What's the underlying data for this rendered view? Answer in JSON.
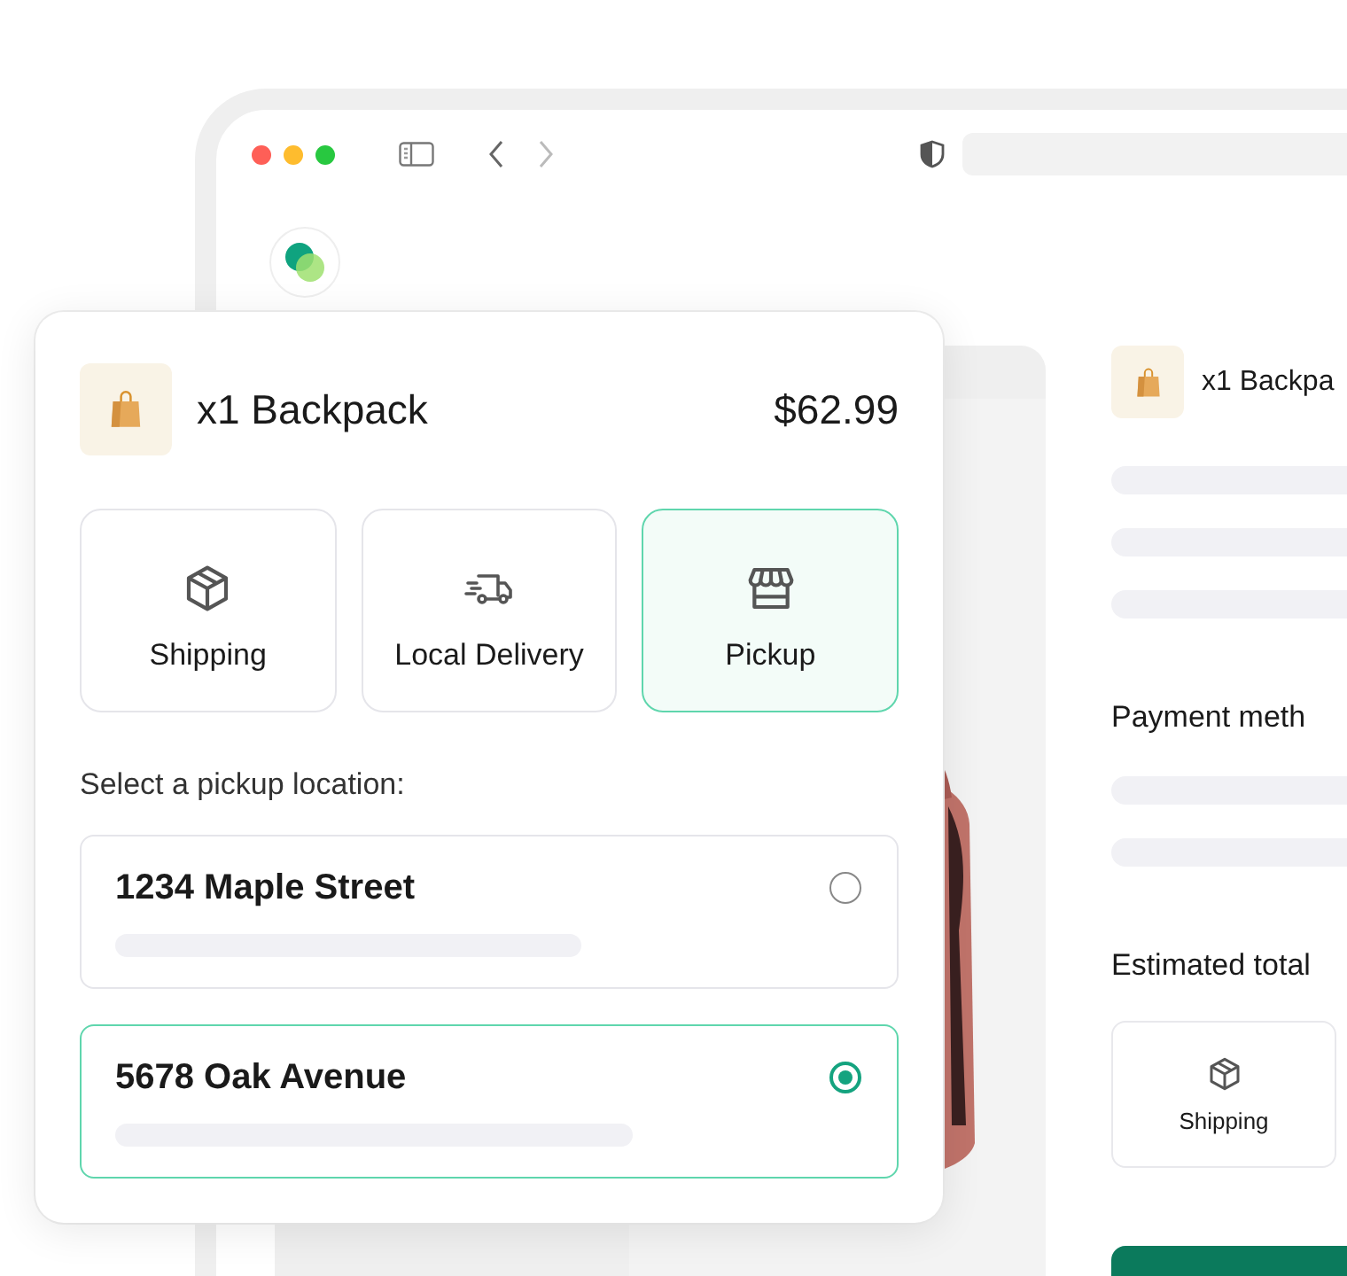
{
  "order_card": {
    "item": {
      "title": "x1 Backpack",
      "price": "$62.99"
    },
    "methods": [
      {
        "label": "Shipping",
        "kind": "box",
        "selected": false
      },
      {
        "label": "Local Delivery",
        "kind": "truck",
        "selected": false
      },
      {
        "label": "Pickup",
        "kind": "store",
        "selected": true
      }
    ],
    "location_prompt": "Select a pickup location:",
    "locations": [
      {
        "name": "1234 Maple Street",
        "selected": false
      },
      {
        "name": "5678 Oak Avenue",
        "selected": true
      }
    ]
  },
  "checkout_page": {
    "item_title": "x1 Backpa",
    "payment_heading": "Payment meth",
    "total_heading": "Estimated total",
    "method": {
      "label": "Shipping",
      "kind": "box"
    }
  }
}
